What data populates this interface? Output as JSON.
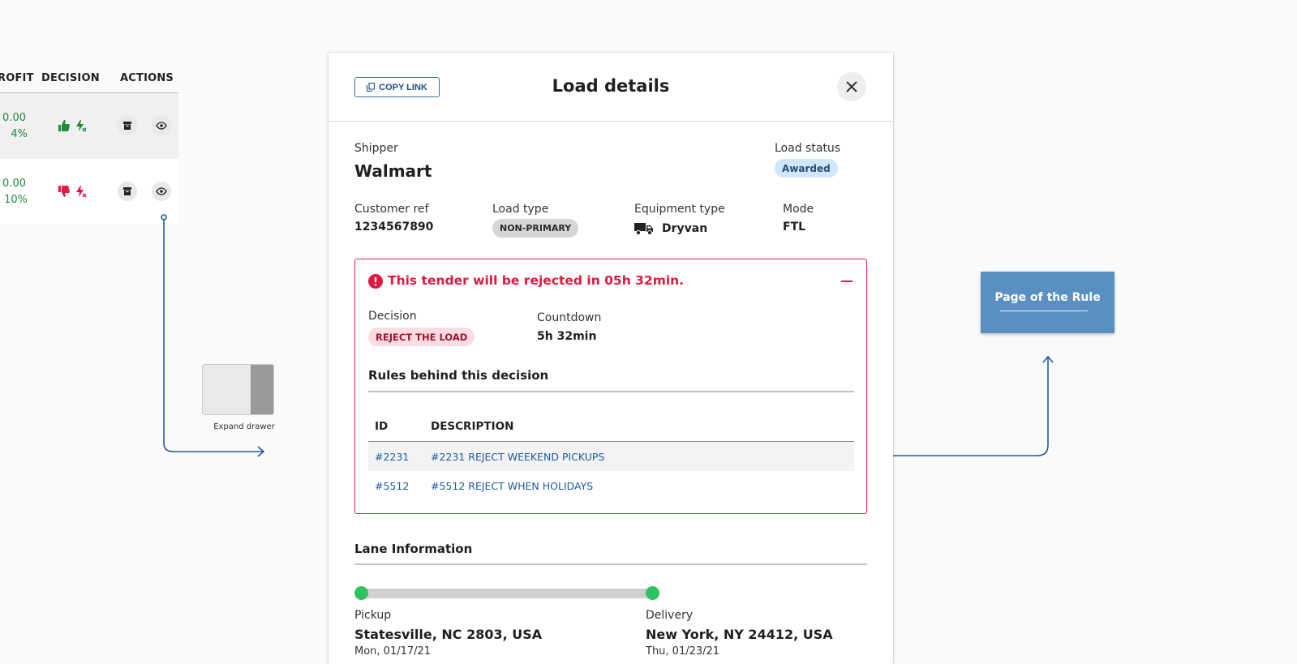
{
  "left_table": {
    "headers": {
      "profit": "ROFIT",
      "decision": "DECISION",
      "actions": "ACTIONS"
    },
    "rows": [
      {
        "amount": "0.00",
        "percent": "4%",
        "decision": "accept",
        "decision_icons": [
          "thumbs-up-icon",
          "lightning-icon"
        ]
      },
      {
        "amount": "0.00",
        "percent": "10%",
        "decision": "reject",
        "decision_icons": [
          "thumbs-down-icon",
          "lightning-icon"
        ]
      }
    ],
    "action_icons": [
      "archive-icon",
      "eye-icon"
    ],
    "row_colors": {
      "accept": "#1e8a3e",
      "reject": "#e0193f"
    }
  },
  "expand_drawer": {
    "label": "Expand drawer"
  },
  "modal": {
    "copy_link": "COPY LINK",
    "title": "Load details",
    "close_icon": "close-icon",
    "shipper": {
      "label": "Shipper",
      "value": "Walmart"
    },
    "load_status": {
      "label": "Load status",
      "value": "Awarded"
    },
    "customer_ref": {
      "label": "Customer ref",
      "value": "1234567890"
    },
    "load_type": {
      "label": "Load type",
      "value": "NON-PRIMARY"
    },
    "equipment_type": {
      "label": "Equipment type",
      "value": "Dryvan",
      "icon": "truck-icon"
    },
    "mode": {
      "label": "Mode",
      "value": "FTL"
    },
    "rejection": {
      "message": "This tender will be rejected in  05h 32min.",
      "decision_label": "Decision",
      "decision_value": "REJECT THE LOAD",
      "countdown_label": "Countdown",
      "countdown_value": "5h 32min",
      "rules_title": "Rules behind this decision",
      "columns": {
        "id": "ID",
        "description": "DESCRIPTION"
      },
      "rules": [
        {
          "id": "#2231",
          "description": "#2231 REJECT WEEKEND PICKUPS"
        },
        {
          "id": "#5512",
          "description": "#5512 REJECT WHEN HOLIDAYS"
        }
      ],
      "accent_color": "#e0193f"
    },
    "lane": {
      "title": "Lane Information",
      "pickup": {
        "label": "Pickup",
        "address": "Statesville, NC 2803, USA",
        "date": "Mon, 01/17/21"
      },
      "delivery": {
        "label": "Delivery",
        "address": "New York, NY 24412, USA",
        "date": "Thu, 01/23/21"
      }
    }
  },
  "rule_page": {
    "label": "Page of the Rule",
    "color": "#5a8fc2"
  }
}
